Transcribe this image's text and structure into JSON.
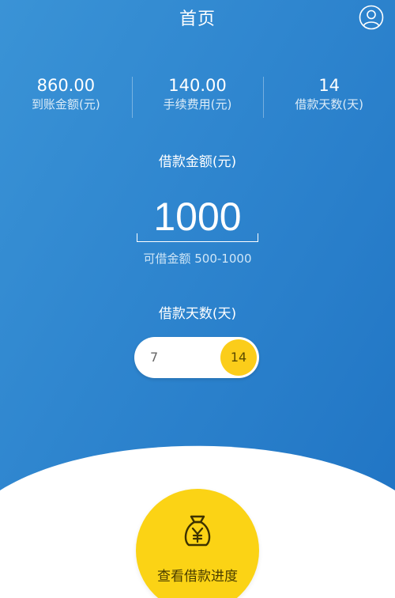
{
  "header": {
    "title": "首页",
    "profile_icon": "user-circle-icon"
  },
  "stats": [
    {
      "value": "860.00",
      "label": "到账金额(元)"
    },
    {
      "value": "140.00",
      "label": "手续费用(元)"
    },
    {
      "value": "14",
      "label": "借款天数(天)"
    }
  ],
  "amount": {
    "label": "借款金额(元)",
    "value": "1000",
    "range_hint": "可借金额 500-1000"
  },
  "days": {
    "label": "借款天数(天)",
    "option_left": "7",
    "option_selected": "14"
  },
  "action": {
    "label": "查看借款进度",
    "icon": "money-bag-yuan-icon"
  },
  "colors": {
    "background_blue": "#2f86cf",
    "accent_yellow": "#fbcd1a",
    "white": "#ffffff"
  }
}
